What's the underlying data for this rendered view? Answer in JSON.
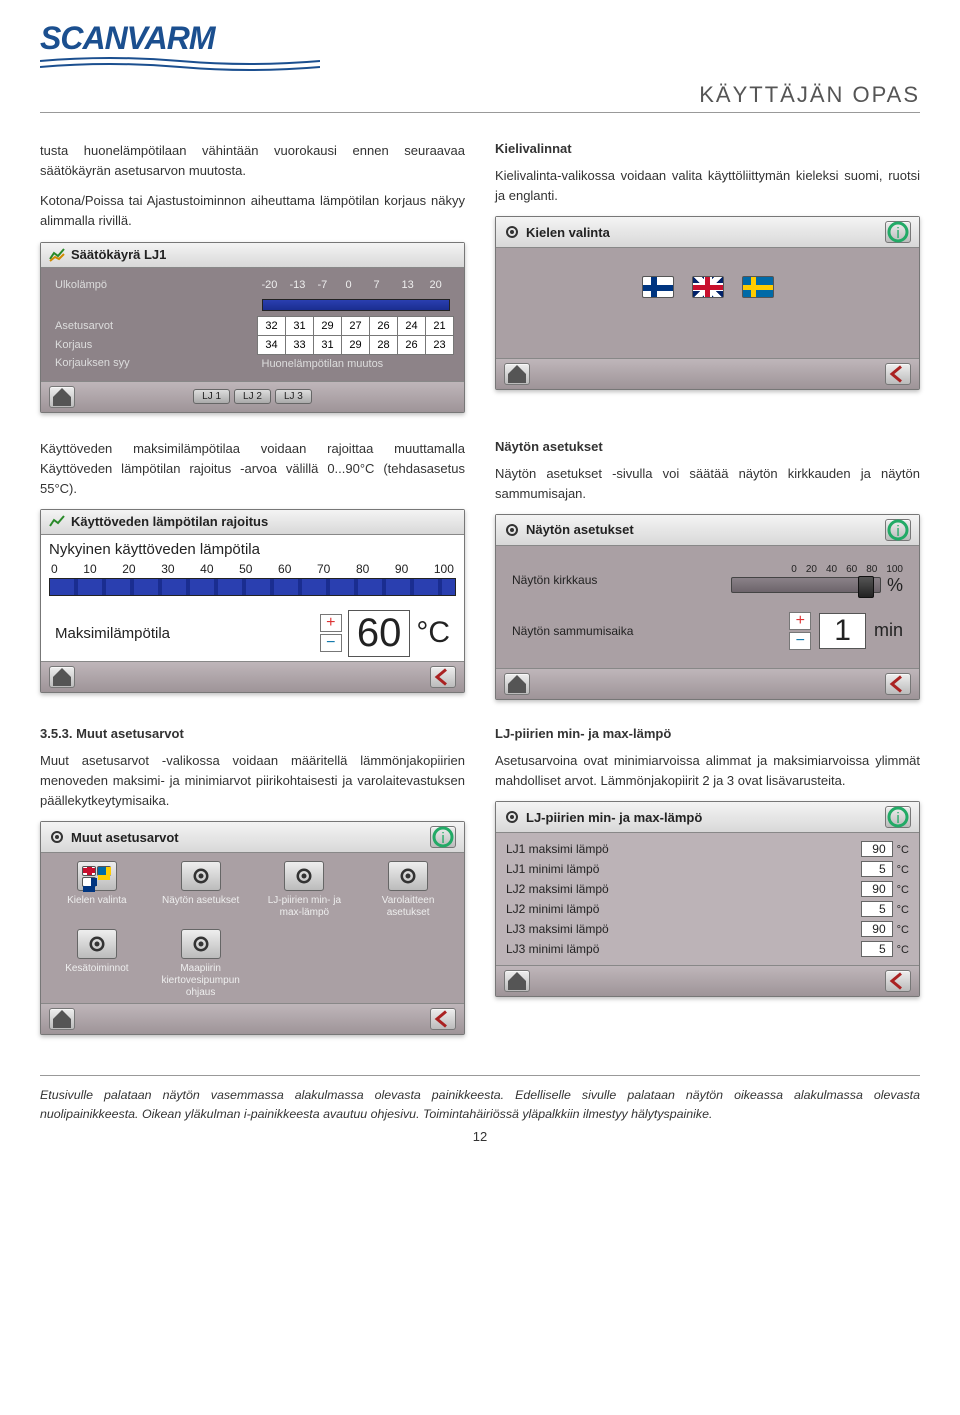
{
  "brand": "SCANVARM",
  "page_title": "KÄYTTÄJÄN OPAS",
  "page_number": "12",
  "left1_p1": "tusta huonelämpötilaan vähintään vuorokausi ennen seuraavaa säätökäyrän asetusarvon muutosta.",
  "left1_p2": "Kotona/Poissa tai Ajastustoiminnon aiheuttama lämpötilan korjaus näkyy alimmalla rivillä.",
  "right1_h": "Kielivalinnat",
  "right1_p": "Kielivalinta-valikossa voidaan valita käyttöliittymän kieleksi suomi, ruotsi ja englanti.",
  "panel_kieli_title": "Kielen valinta",
  "panel_sk_title": "Säätökäyrä LJ1",
  "sk": {
    "row_ulko": "Ulkolämpö",
    "row_aset": "Asetusarvot",
    "row_korj": "Korjaus",
    "row_syy": "Korjauksen syy",
    "row_syy_val": "Huonelämpötilan muutos",
    "ulko": [
      "-20",
      "-13",
      "-7",
      "0",
      "7",
      "13",
      "20"
    ],
    "aset": [
      "32",
      "31",
      "29",
      "27",
      "26",
      "24",
      "21"
    ],
    "korj": [
      "34",
      "33",
      "31",
      "29",
      "28",
      "26",
      "23"
    ],
    "tabs": [
      "LJ 1",
      "LJ 2",
      "LJ 3"
    ]
  },
  "left2_p": "Käyttöveden maksimilämpötilaa voidaan rajoittaa muuttamalla Käyttöveden lämpötilan rajoitus -arvoa välillä 0...90°C (tehdasasetus 55°C).",
  "right2_h": "Näytön asetukset",
  "right2_p": "Näytön asetukset -sivulla voi säätää näytön kirkkauden ja näytön sammumisajan.",
  "panel_kv_title": "Käyttöveden lämpötilan rajoitus",
  "kv": {
    "cur_label": "Nykyinen käyttöveden lämpötila",
    "scale": [
      "0",
      "10",
      "20",
      "30",
      "40",
      "50",
      "60",
      "70",
      "80",
      "90",
      "100"
    ],
    "max_label": "Maksimilämpötila",
    "value": "60",
    "unit": "°C"
  },
  "panel_na_title": "Näytön asetukset",
  "na": {
    "brightness_label": "Näytön kirkkaus",
    "brightness_ticks": [
      "0",
      "20",
      "40",
      "60",
      "80",
      "100"
    ],
    "brightness_unit": "%",
    "timeout_label": "Näytön sammumisaika",
    "timeout_value": "1",
    "timeout_unit": "min"
  },
  "sec_num": "3.5.3. Muut asetusarvot",
  "left3_p": "Muut asetusarvot -valikossa voidaan määritellä lämmönjakopiirien menoveden maksimi- ja minimiarvot piirikohtaisesti ja varolaitevastuksen päällekytkeytymisaika.",
  "right3_h": "LJ-piirien min- ja max-lämpö",
  "right3_p": "Asetusarvoina ovat minimiarvoissa alimmat ja maksimiarvoissa ylimmät mahdolliset arvot. Lämmönjakopiirit 2 ja 3 ovat lisävarusteita.",
  "panel_ma_title": "Muut asetusarvot",
  "ma_items": [
    "Kielen valinta",
    "Näytön asetukset",
    "LJ-piirien min- ja max-lämpö",
    "Varolaitteen asetukset",
    "Kesätoiminnot",
    "Maapiirin kiertovesipumpun ohjaus"
  ],
  "panel_lj_title": "LJ-piirien min- ja max-lämpö",
  "lj_rows": [
    {
      "label": "LJ1 maksimi lämpö",
      "val": "90",
      "unit": "°C"
    },
    {
      "label": "LJ1 minimi lämpö",
      "val": "5",
      "unit": "°C"
    },
    {
      "label": "LJ2 maksimi lämpö",
      "val": "90",
      "unit": "°C"
    },
    {
      "label": "LJ2 minimi lämpö",
      "val": "5",
      "unit": "°C"
    },
    {
      "label": "LJ3 maksimi lämpö",
      "val": "90",
      "unit": "°C"
    },
    {
      "label": "LJ3 minimi lämpö",
      "val": "5",
      "unit": "°C"
    }
  ],
  "footer": "Etusivulle palataan näytön vasemmassa alakulmassa olevasta painikkeesta. Edelliselle sivulle palataan näytön oikeassa alakulmassa olevasta nuolipainikkeesta. Oikean yläkulman i-painikkeesta avautuu ohjesivu. Toimintahäiriössä yläpalkkiin ilmestyy hälytyspainike."
}
